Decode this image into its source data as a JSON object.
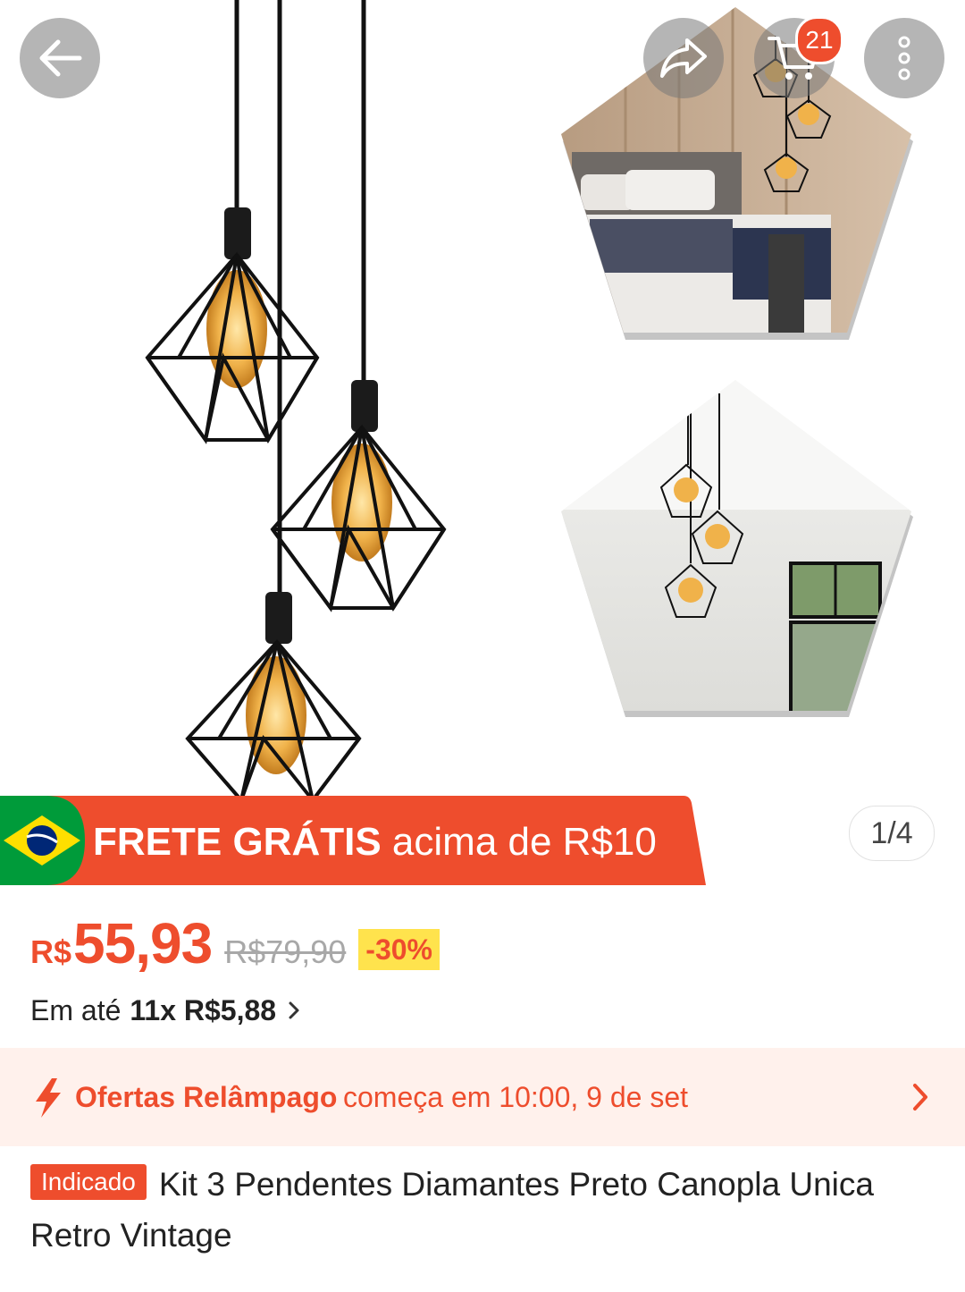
{
  "gallery": {
    "current": "1",
    "total": "4",
    "indicator": "1/4"
  },
  "header": {
    "cart_count": "21",
    "icons": [
      "arrow-left-icon",
      "share-icon",
      "cart-icon",
      "more-vertical-icon"
    ]
  },
  "shipping_banner": {
    "bold_text": "FRETE GRÁTIS",
    "rest_text": "acima de R$10",
    "flag": "brazil-flag-icon"
  },
  "price": {
    "currency": "R$",
    "value": "55,93",
    "original": "R$79,90",
    "discount": "-30%"
  },
  "installment": {
    "prefix": "Em até",
    "value": "11x R$5,88",
    "chevron": "chevron-right-icon"
  },
  "flash_sale": {
    "title": "Ofertas Relâmpago",
    "subtitle": "começa em 10:00, 9 de set",
    "icon": "lightning-icon"
  },
  "product": {
    "badge": "Indicado",
    "title": "Kit 3 Pendentes Diamantes Preto Canopla Unica Retro Vintage"
  },
  "colors": {
    "accent": "#ee4d2d",
    "discount_bg": "#ffe34d",
    "flash_bg": "#fff1ec"
  }
}
